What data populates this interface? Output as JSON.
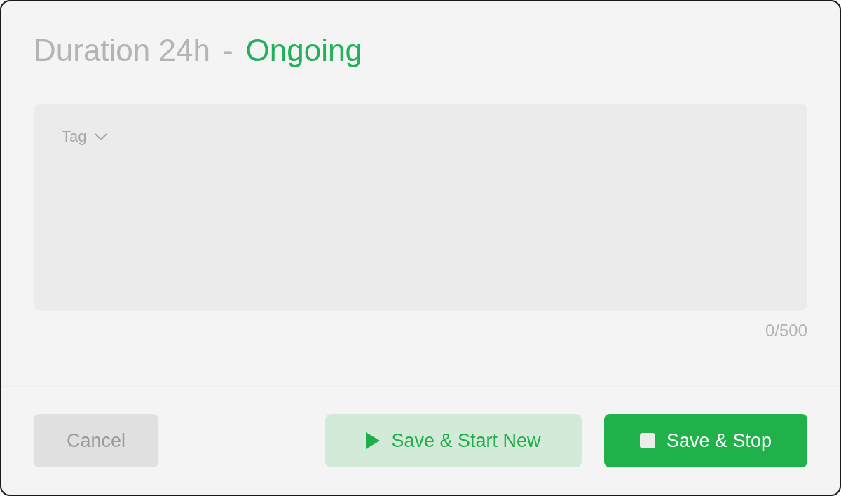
{
  "header": {
    "title": "Duration 24h",
    "separator": "-",
    "status": "Ongoing"
  },
  "note": {
    "tag": "Tag",
    "counter": "0/500"
  },
  "buttons": [
    {
      "label": "Cancel",
      "kind": "cancel"
    },
    {
      "label": "Save & Start New",
      "kind": "secondary"
    },
    {
      "label": "Save & Stop",
      "kind": "primary"
    }
  ]
}
